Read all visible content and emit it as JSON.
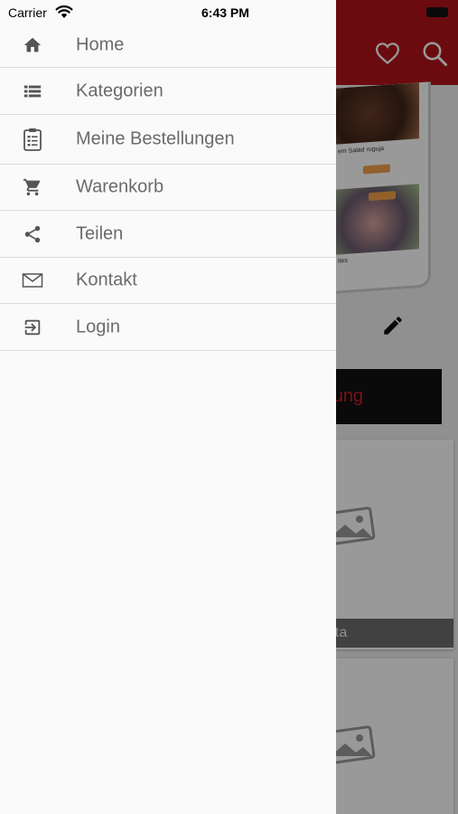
{
  "status_bar": {
    "carrier": "Carrier",
    "time": "6:43 PM"
  },
  "drawer": {
    "items": [
      {
        "label": "Home",
        "icon": "home-icon"
      },
      {
        "label": "Kategorien",
        "icon": "list-icon"
      },
      {
        "label": "Meine Bestellungen",
        "icon": "clipboard-icon"
      },
      {
        "label": "Warenkorb",
        "icon": "cart-icon"
      },
      {
        "label": "Teilen",
        "icon": "share-icon"
      },
      {
        "label": "Kontakt",
        "icon": "mail-icon"
      },
      {
        "label": "Login",
        "icon": "login-icon"
      }
    ]
  },
  "background": {
    "header_color": "#b3131b",
    "promo": {
      "text1": "em Salad ruguja",
      "text2": "ites"
    },
    "cta_label": "holung",
    "card_label": "asta"
  },
  "colors": {
    "accent": "#b3131b",
    "drawer_text": "#6b6b6b",
    "icon": "#555555"
  }
}
